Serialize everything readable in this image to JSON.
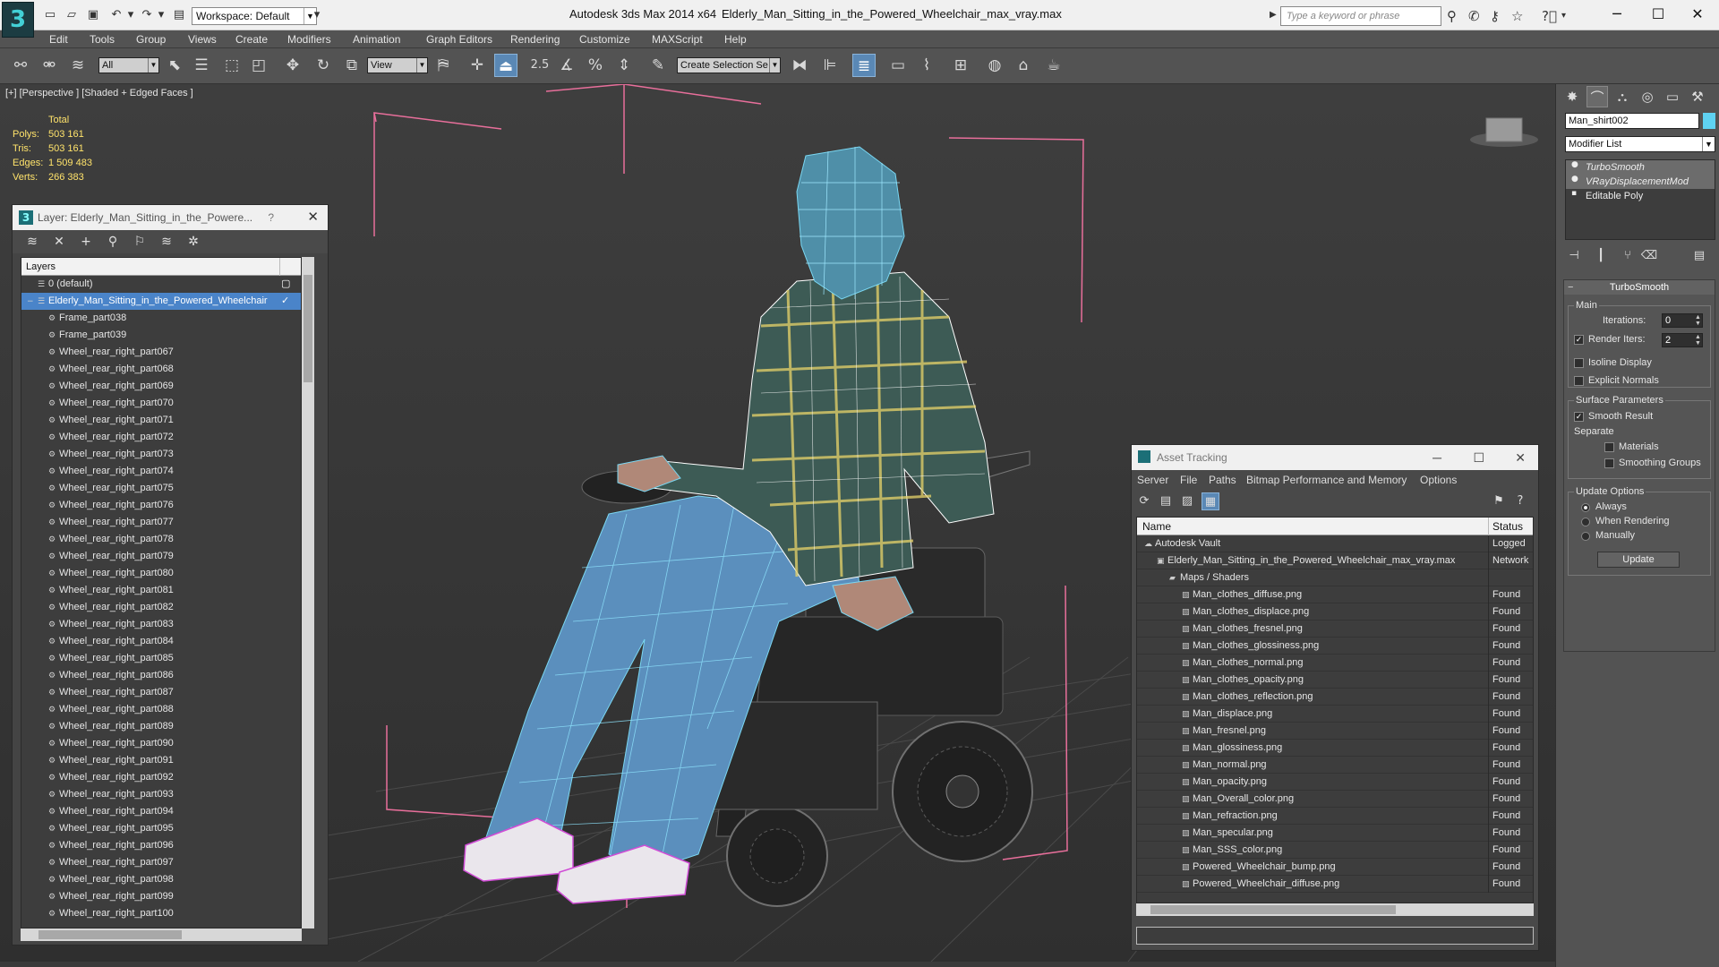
{
  "titlebar": {
    "workspace": "Workspace: Default",
    "app_title": "Autodesk 3ds Max  2014 x64",
    "file_title": "Elderly_Man_Sitting_in_the_Powered_Wheelchair_max_vray.max",
    "search_placeholder": "Type a keyword or phrase"
  },
  "menu": [
    "Edit",
    "Tools",
    "Group",
    "Views",
    "Create",
    "Modifiers",
    "Animation",
    "Graph Editors",
    "Rendering",
    "Customize",
    "MAXScript",
    "Help"
  ],
  "toolbar": {
    "selection_filter": "All",
    "ref_coord": "View",
    "snap_label": "2.5",
    "selection_set": "Create Selection Se"
  },
  "viewport": {
    "label": "[+] [Perspective ] [Shaded + Edged Faces ]",
    "stats": {
      "header": "Total",
      "rows": [
        {
          "k": "Polys:",
          "v": "503 161"
        },
        {
          "k": "Tris:",
          "v": "503 161"
        },
        {
          "k": "Edges:",
          "v": "1 509 483"
        },
        {
          "k": "Verts:",
          "v": "266 383"
        }
      ]
    }
  },
  "layer_window": {
    "title": "Layer: Elderly_Man_Sitting_in_the_Powere...",
    "help": "?",
    "header": "Layers",
    "default_layer": "0 (default)",
    "selected_layer": "Elderly_Man_Sitting_in_the_Powered_Wheelchair",
    "items": [
      "Frame_part038",
      "Frame_part039",
      "Wheel_rear_right_part067",
      "Wheel_rear_right_part068",
      "Wheel_rear_right_part069",
      "Wheel_rear_right_part070",
      "Wheel_rear_right_part071",
      "Wheel_rear_right_part072",
      "Wheel_rear_right_part073",
      "Wheel_rear_right_part074",
      "Wheel_rear_right_part075",
      "Wheel_rear_right_part076",
      "Wheel_rear_right_part077",
      "Wheel_rear_right_part078",
      "Wheel_rear_right_part079",
      "Wheel_rear_right_part080",
      "Wheel_rear_right_part081",
      "Wheel_rear_right_part082",
      "Wheel_rear_right_part083",
      "Wheel_rear_right_part084",
      "Wheel_rear_right_part085",
      "Wheel_rear_right_part086",
      "Wheel_rear_right_part087",
      "Wheel_rear_right_part088",
      "Wheel_rear_right_part089",
      "Wheel_rear_right_part090",
      "Wheel_rear_right_part091",
      "Wheel_rear_right_part092",
      "Wheel_rear_right_part093",
      "Wheel_rear_right_part094",
      "Wheel_rear_right_part095",
      "Wheel_rear_right_part096",
      "Wheel_rear_right_part097",
      "Wheel_rear_right_part098",
      "Wheel_rear_right_part099",
      "Wheel_rear_right_part100"
    ]
  },
  "asset_window": {
    "title": "Asset Tracking",
    "menu": [
      "Server",
      "File",
      "Paths",
      "Bitmap Performance and Memory",
      "Options"
    ],
    "col_name": "Name",
    "col_status": "Status",
    "rows": [
      {
        "name": "Autodesk Vault",
        "status": "Logged",
        "level": 1
      },
      {
        "name": "Elderly_Man_Sitting_in_the_Powered_Wheelchair_max_vray.max",
        "status": "Network",
        "level": 2
      },
      {
        "name": "Maps / Shaders",
        "status": "",
        "level": 3
      },
      {
        "name": "Man_clothes_diffuse.png",
        "status": "Found",
        "level": 4
      },
      {
        "name": "Man_clothes_displace.png",
        "status": "Found",
        "level": 4
      },
      {
        "name": "Man_clothes_fresnel.png",
        "status": "Found",
        "level": 4
      },
      {
        "name": "Man_clothes_glossiness.png",
        "status": "Found",
        "level": 4
      },
      {
        "name": "Man_clothes_normal.png",
        "status": "Found",
        "level": 4
      },
      {
        "name": "Man_clothes_opacity.png",
        "status": "Found",
        "level": 4
      },
      {
        "name": "Man_clothes_reflection.png",
        "status": "Found",
        "level": 4
      },
      {
        "name": "Man_displace.png",
        "status": "Found",
        "level": 4
      },
      {
        "name": "Man_fresnel.png",
        "status": "Found",
        "level": 4
      },
      {
        "name": "Man_glossiness.png",
        "status": "Found",
        "level": 4
      },
      {
        "name": "Man_normal.png",
        "status": "Found",
        "level": 4
      },
      {
        "name": "Man_opacity.png",
        "status": "Found",
        "level": 4
      },
      {
        "name": "Man_Overall_color.png",
        "status": "Found",
        "level": 4
      },
      {
        "name": "Man_refraction.png",
        "status": "Found",
        "level": 4
      },
      {
        "name": "Man_specular.png",
        "status": "Found",
        "level": 4
      },
      {
        "name": "Man_SSS_color.png",
        "status": "Found",
        "level": 4
      },
      {
        "name": "Powered_Wheelchair_bump.png",
        "status": "Found",
        "level": 4
      },
      {
        "name": "Powered_Wheelchair_diffuse.png",
        "status": "Found",
        "level": 4
      }
    ]
  },
  "command_panel": {
    "object_name": "Man_shirt002",
    "object_color": "#5fd2f2",
    "modifier_list": "Modifier List",
    "stack": [
      "TurboSmooth",
      "VRayDisplacementMod",
      "Editable Poly"
    ],
    "turbosmooth": {
      "title": "TurboSmooth",
      "main": "Main",
      "iterations_label": "Iterations:",
      "iterations": "0",
      "render_iters_label": "Render Iters:",
      "render_iters": "2",
      "isoline": "Isoline Display",
      "explicit_normals": "Explicit Normals",
      "surface_params": "Surface Parameters",
      "smooth_result": "Smooth Result",
      "separate": "Separate",
      "materials": "Materials",
      "smoothing_groups": "Smoothing Groups",
      "update_options": "Update Options",
      "always": "Always",
      "when_rendering": "When Rendering",
      "manually": "Manually",
      "update_btn": "Update"
    }
  }
}
